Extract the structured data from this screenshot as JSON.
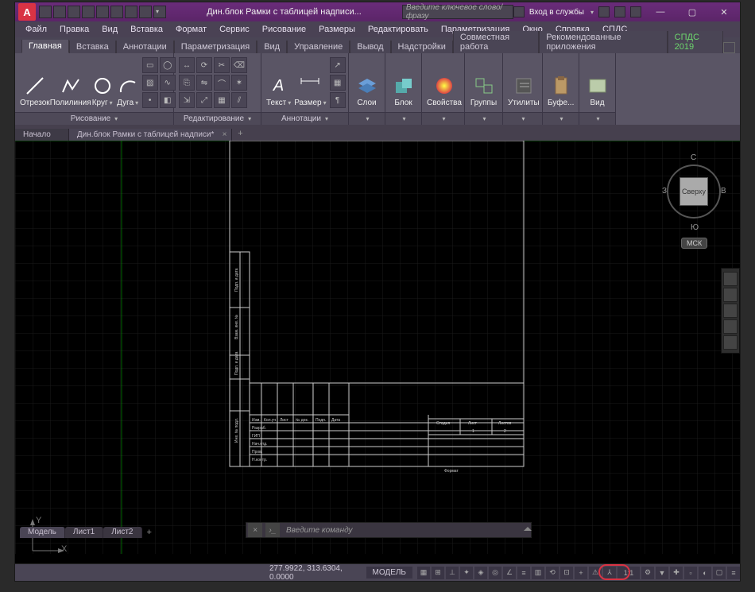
{
  "title": "Дин.блок Рамки с таблицей надписи...",
  "search_placeholder": "Введите ключевое слово/фразу",
  "login_label": "Вход в службы",
  "menubar": [
    "Файл",
    "Правка",
    "Вид",
    "Вставка",
    "Формат",
    "Сервис",
    "Рисование",
    "Размеры",
    "Редактировать",
    "Параметризация",
    "Окно",
    "Справка",
    "СПДС"
  ],
  "ribbon_tabs": [
    "Главная",
    "Вставка",
    "Аннотации",
    "Параметризация",
    "Вид",
    "Управление",
    "Вывод",
    "Надстройки",
    "Совместная работа",
    "Рекомендованные приложения",
    "СПДС 2019"
  ],
  "ribbon_active": 0,
  "panels": {
    "draw": {
      "label": "Рисование",
      "items": {
        "otrezok": "Отрезок",
        "polilinia": "Полилиния",
        "krug": "Круг",
        "duga": "Дуга"
      }
    },
    "edit": {
      "label": "Редактирование"
    },
    "annot": {
      "label": "Аннотации",
      "tekst": "Текст",
      "razmer": "Размер"
    },
    "layers": {
      "label": "Слои"
    },
    "block": {
      "label": "Блок"
    },
    "properties": {
      "label": "Свойства"
    },
    "groups": {
      "label": "Группы"
    },
    "utils": {
      "label": "Утилиты"
    },
    "clipboard": {
      "label": "Буфе..."
    },
    "view": {
      "label": "Вид"
    }
  },
  "doc_tabs": [
    {
      "label": "Начало",
      "active": false
    },
    {
      "label": "Дин.блок Рамки с таблицей надписи*",
      "active": true
    }
  ],
  "viewcube": {
    "top": "Сверху",
    "n": "С",
    "s": "Ю",
    "e": "В",
    "w": "З",
    "cs": "МСК"
  },
  "ucs": {
    "x": "X",
    "y": "Y"
  },
  "layout_tabs": [
    {
      "label": "Модель",
      "active": true
    },
    {
      "label": "Лист1",
      "active": false
    },
    {
      "label": "Лист2",
      "active": false
    }
  ],
  "cmd_placeholder": "Введите команду",
  "status": {
    "coords": "277.9922, 313.6304, 0.0000",
    "model": "МОДЕЛЬ",
    "scale": "1:1"
  },
  "title_block": {
    "row_labels": [
      "Изм.",
      "Кол.уч",
      "Лист",
      "№ док.",
      "Подп.",
      "Дата"
    ],
    "small_rows": [
      "Разраб.",
      "ГИП",
      "Нач.отд.",
      "Пров.",
      "Н.контр."
    ],
    "right_head": [
      "Стадия",
      "Лист",
      "Листов"
    ],
    "right_vals": [
      "",
      "1",
      "2"
    ],
    "footer": "Формат",
    "side_cols": [
      "Подп. и дата",
      "Взам. инв. №",
      "Подп. и дата",
      "Инв. № подл."
    ]
  }
}
